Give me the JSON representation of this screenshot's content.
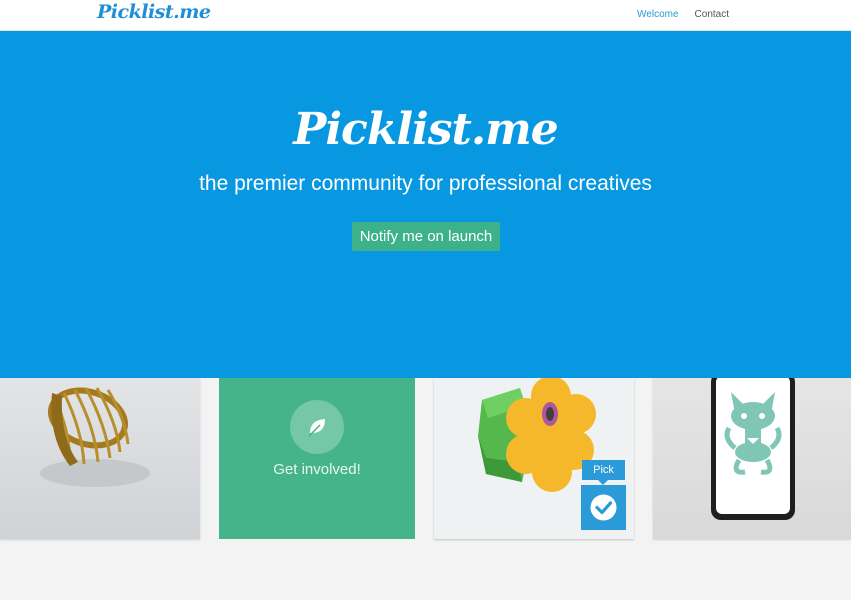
{
  "nav": {
    "logo": "Picklist.me",
    "links": [
      {
        "label": "Welcome",
        "active": true
      },
      {
        "label": "Contact",
        "active": false
      }
    ]
  },
  "hero": {
    "logo": "Picklist.me",
    "tagline": "the premier community for professional creatives",
    "cta_label": "Notify me on launch",
    "background_color": "#0898e1",
    "cta_color": "#3db28a"
  },
  "tiles": {
    "involve": {
      "label": "Get involved!",
      "icon": "leaf-icon",
      "color": "#46b48a"
    },
    "pick": {
      "label": "Pick",
      "icon": "check-icon",
      "color": "#2a9ad9"
    }
  }
}
